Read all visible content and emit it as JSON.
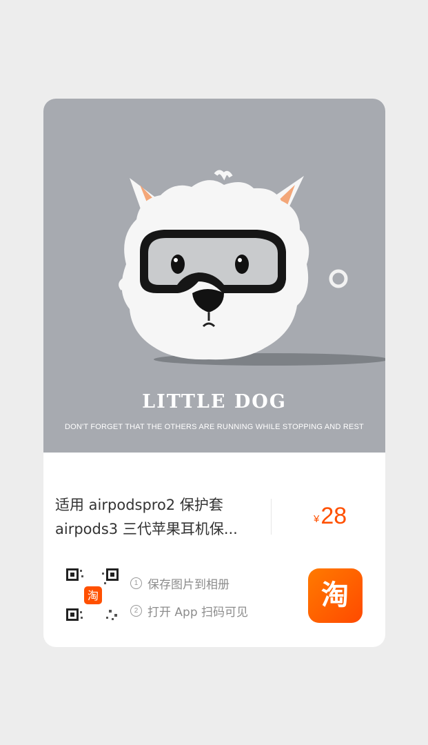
{
  "hero": {
    "title": "LITTLE DOG",
    "subtitle": "DON'T FORGET THAT THE OTHERS ARE RUNNING WHILE STOPPING AND REST",
    "image": "white-dog-airpods-case"
  },
  "product": {
    "title_line1": "适用 airpodspro2 保护套",
    "title_line2": "airpods3 三代苹果耳机保...",
    "price_symbol": "¥",
    "price": "28"
  },
  "share": {
    "qr_badge": "淘",
    "step1_num": "1",
    "step1": "保存图片到相册",
    "step2_num": "2",
    "step2": "打开 App 扫码可见"
  },
  "app_icon": {
    "name": "taobao-icon",
    "glyph": "淘"
  },
  "colors": {
    "accent": "#ff5000",
    "hero_bg": "#a7aab0",
    "page_bg": "#ededed"
  }
}
